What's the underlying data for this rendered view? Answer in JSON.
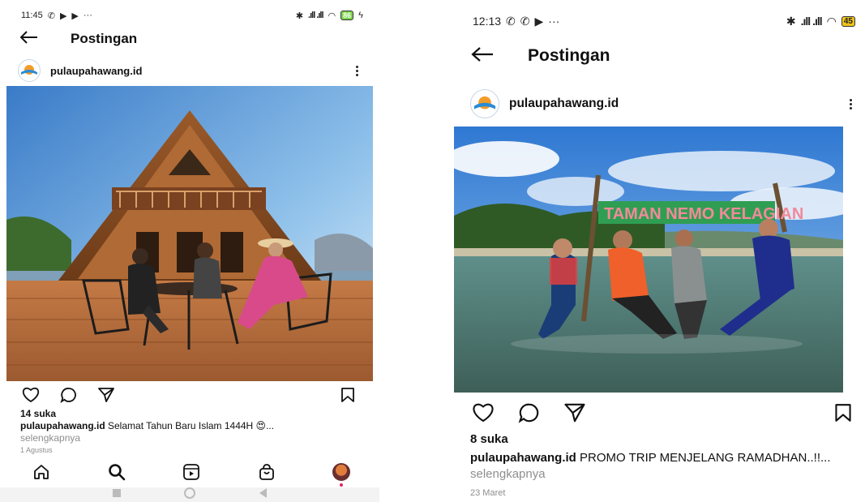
{
  "left": {
    "status": {
      "time": "11:45",
      "battery": "86"
    },
    "title": "Postingan",
    "username": "pulaupahawang.id",
    "likes": "14 suka",
    "caption_user": "pulaupahawang.id",
    "caption_text": " Selamat Tahun Baru Islam 1444H 😍...",
    "more_label": "selengkapnya",
    "date": "1 Agustus",
    "nav": [
      "home-icon",
      "search-icon",
      "reels-icon",
      "shop-icon",
      "profile-avatar"
    ]
  },
  "right": {
    "status": {
      "time": "12:13",
      "battery": "45"
    },
    "title": "Postingan",
    "username": "pulaupahawang.id",
    "likes": "8 suka",
    "caption_user": "pulaupahawang.id",
    "caption_text": " PROMO TRIP MENJELANG RAMADHAN..!!...",
    "more_label": " selengkapnya",
    "date": "23 Maret",
    "banner_text": "TAMAN NEMO KELAGIAN"
  },
  "colors": {
    "accent": "#e0245e",
    "muted": "#8e8e8e",
    "sky": "#3c86d6",
    "sea": "#4f7a6e"
  }
}
